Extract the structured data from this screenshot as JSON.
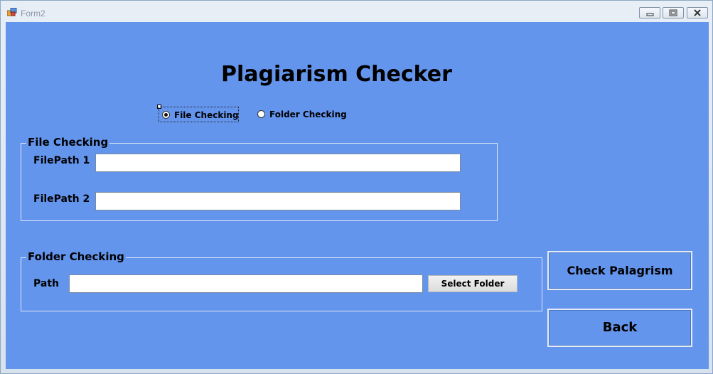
{
  "window": {
    "title": "Form2"
  },
  "heading": "Plagiarism Checker",
  "mode_selector": {
    "options": [
      {
        "label": "File Checking",
        "selected": true
      },
      {
        "label": "Folder Checking",
        "selected": false
      }
    ]
  },
  "file_checking": {
    "title": "File Checking",
    "filepath1_label": "FilePath 1",
    "filepath1_value": "",
    "filepath2_label": "FilePath 2",
    "filepath2_value": ""
  },
  "folder_checking": {
    "title": "Folder Checking",
    "path_label": "Path",
    "path_value": "",
    "select_folder_label": "Select Folder"
  },
  "actions": {
    "check_label": "Check Palagrism",
    "back_label": "Back"
  },
  "colors": {
    "form_background": "#6495ed"
  }
}
